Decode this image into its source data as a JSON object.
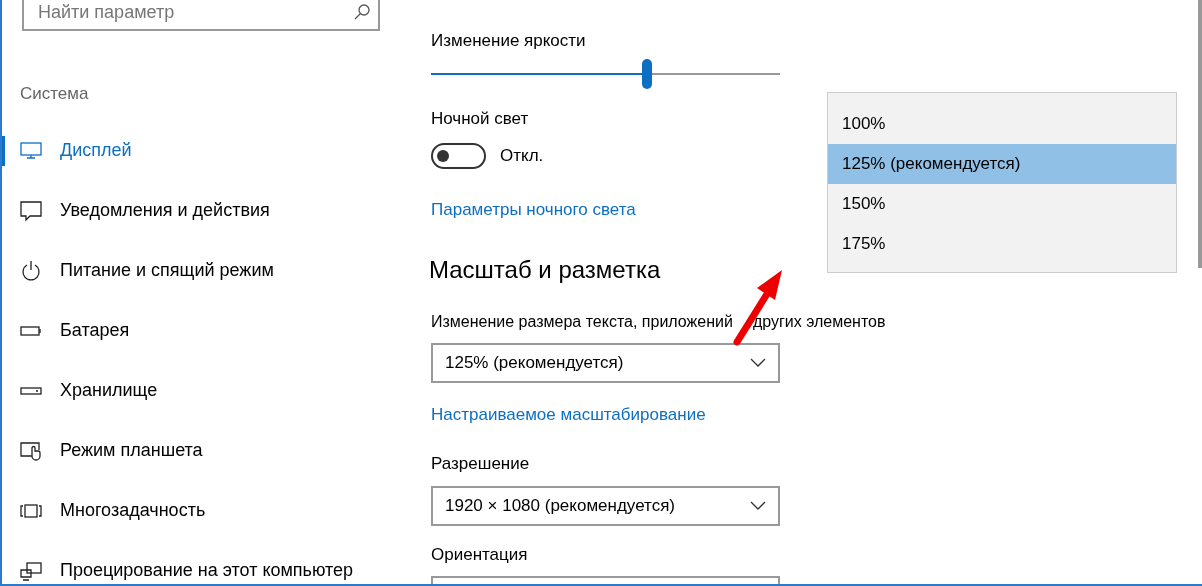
{
  "search": {
    "placeholder": "Найти параметр"
  },
  "sidebar": {
    "heading": "Система",
    "items": [
      {
        "label": "Дисплей",
        "kind": "monitor",
        "selected": true
      },
      {
        "label": "Уведомления и действия",
        "kind": "message",
        "selected": false
      },
      {
        "label": "Питание и спящий режим",
        "kind": "power",
        "selected": false
      },
      {
        "label": "Батарея",
        "kind": "battery",
        "selected": false
      },
      {
        "label": "Хранилище",
        "kind": "storage",
        "selected": false
      },
      {
        "label": "Режим планшета",
        "kind": "tablet",
        "selected": false
      },
      {
        "label": "Многозадачность",
        "kind": "multitask",
        "selected": false
      },
      {
        "label": "Проецирование на этот компьютер",
        "kind": "project",
        "selected": false
      }
    ]
  },
  "brightness": {
    "label": "Изменение яркости",
    "level": 0.62
  },
  "night_light": {
    "label": "Ночной свет",
    "on": false,
    "state_text": "Откл.",
    "link": "Параметры ночного света"
  },
  "scale_section": {
    "heading": "Масштаб и разметка",
    "scale": {
      "label_parts": [
        "Изменение размера текста, приложений",
        "других элементов"
      ],
      "value": "125% (рекомендуется)"
    },
    "custom_link": "Настраиваемое масштабирование",
    "resolution": {
      "label": "Разрешение",
      "value": "1920 × 1080 (рекомендуется)"
    },
    "orientation": {
      "label": "Ориентация"
    }
  },
  "scale_menu": [
    {
      "label": "100%",
      "selected": false
    },
    {
      "label": "125% (рекомендуется)",
      "selected": true
    },
    {
      "label": "150%",
      "selected": false
    },
    {
      "label": "175%",
      "selected": false
    }
  ]
}
